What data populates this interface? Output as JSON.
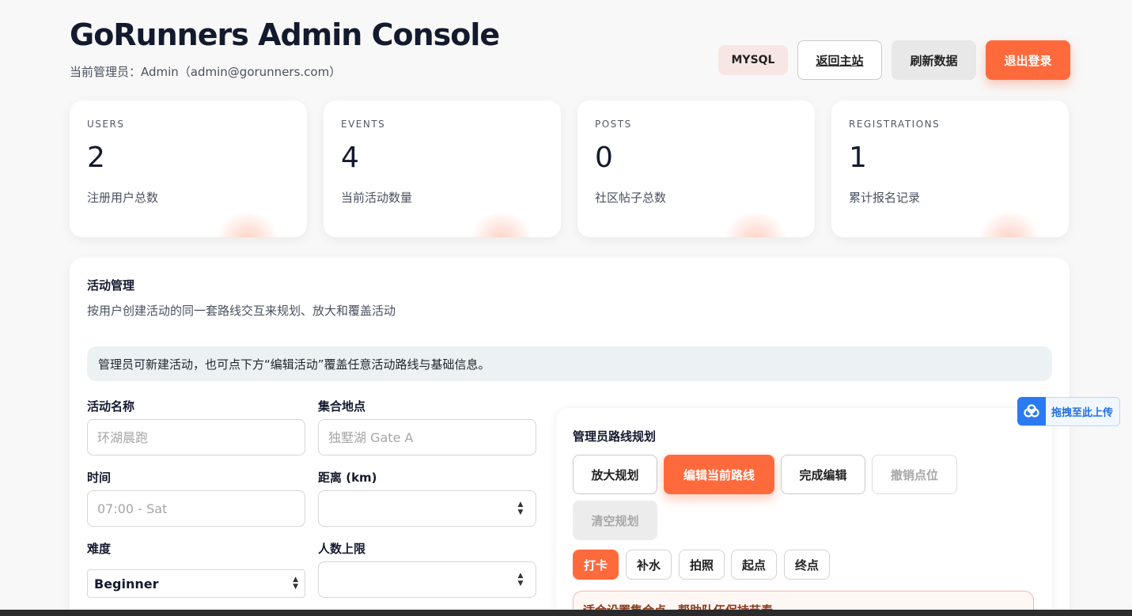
{
  "header": {
    "title": "GoRunners Admin Console",
    "admin_line": "当前管理员：Admin（admin@gorunners.com）",
    "db_badge": "MYSQL",
    "home_label": "返回主站",
    "refresh_label": "刷新数据",
    "logout_label": "退出登录"
  },
  "stats": [
    {
      "label": "USERS",
      "value": "2",
      "desc": "注册用户总数"
    },
    {
      "label": "EVENTS",
      "value": "4",
      "desc": "当前活动数量"
    },
    {
      "label": "POSTS",
      "value": "0",
      "desc": "社区帖子总数"
    },
    {
      "label": "REGISTRATIONS",
      "value": "1",
      "desc": "累计报名记录"
    }
  ],
  "events": {
    "title": "活动管理",
    "subtitle": "按用户创建活动的同一套路线交互来规划、放大和覆盖活动",
    "notice": "管理员可新建活动，也可点下方“编辑活动”覆盖任意活动路线与基础信息。",
    "form": {
      "name_label": "活动名称",
      "name_placeholder": "环湖晨跑",
      "location_label": "集合地点",
      "location_placeholder": "独墅湖 Gate A",
      "time_label": "时间",
      "time_placeholder": "07:00 - Sat",
      "distance_label": "距离 (km)",
      "difficulty_label": "难度",
      "difficulty_value": "Beginner",
      "capacity_label": "人数上限"
    }
  },
  "route": {
    "title": "管理员路线规划",
    "buttons": {
      "zoom": "放大规划",
      "edit": "编辑当前路线",
      "finish": "完成编辑",
      "undo": "撤销点位",
      "clear": "清空规划"
    },
    "chips": [
      "打卡",
      "补水",
      "拍照",
      "起点",
      "终点"
    ],
    "hint": "适合设置集合点，帮助队伍保持节奏"
  },
  "upload": {
    "label": "拖拽至此上传",
    "icon": "cloud-upload-icon",
    "color": "#2b7bf0"
  },
  "colors": {
    "accent": "#ff6a3d",
    "title": "#141a2e"
  }
}
